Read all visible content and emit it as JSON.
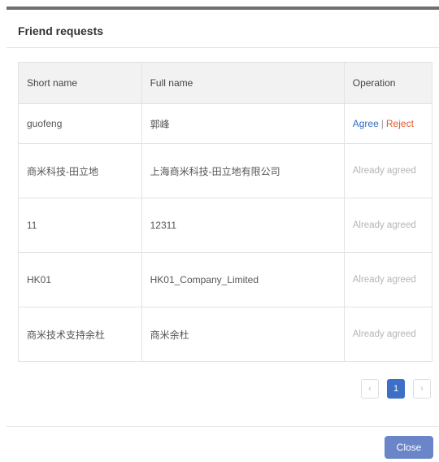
{
  "dialog": {
    "title": "Friend requests",
    "close_label": "Close"
  },
  "table": {
    "headers": {
      "short_name": "Short name",
      "full_name": "Full name",
      "operation": "Operation"
    },
    "first_row": {
      "short": "guofeng",
      "full": "郭峰",
      "agree": "Agree",
      "separator": "|",
      "reject": "Reject"
    },
    "rows": [
      {
        "short": "商米科技-田立地",
        "full": "上海商米科技-田立地有限公司",
        "status": "Already agreed"
      },
      {
        "short": "11",
        "full": "12311",
        "status": "Already agreed"
      },
      {
        "short": "HK01",
        "full": "HK01_Company_Limited",
        "status": "Already agreed"
      },
      {
        "short": "商米技术支持余杜",
        "full": "商米余杜",
        "status": "Already agreed"
      }
    ]
  },
  "pagination": {
    "prev": "‹",
    "current_page": "1",
    "next": "›"
  },
  "colors": {
    "primary": "#3d6fc6",
    "agree": "#2f6bc4",
    "reject": "#e0582b",
    "close_button": "#6a86c9"
  }
}
